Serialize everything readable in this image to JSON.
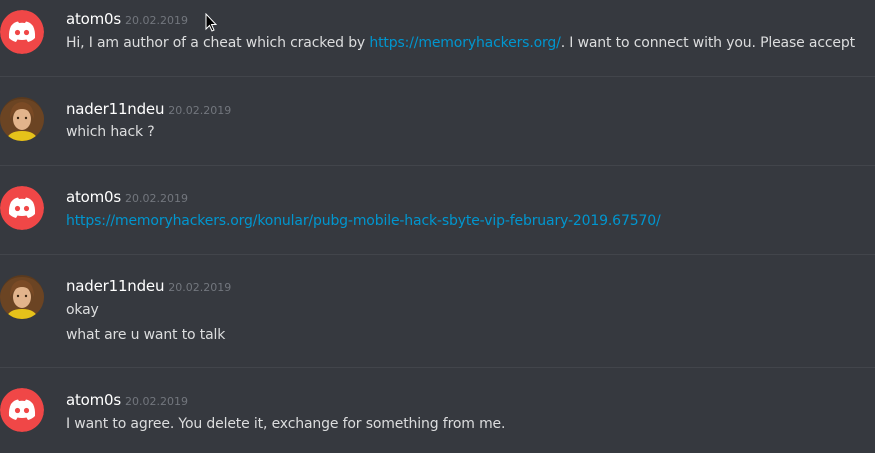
{
  "colors": {
    "background": "#36393f",
    "divider": "#42454b",
    "username": "#ffffff",
    "timestamp": "#72767d",
    "message_text": "#dcddde",
    "link": "#0096cf",
    "discord_avatar_bg": "#f04747"
  },
  "messages": [
    {
      "author": "atom0s",
      "timestamp": "20.02.2019",
      "avatar_icon": "discord-logo-icon",
      "lines": [
        {
          "prefix": "Hi, I am author of a cheat which cracked by ",
          "link": "https://memoryhackers.org/",
          "suffix": ". I want to connect with you. Please accept"
        }
      ]
    },
    {
      "author": "nader11ndeu",
      "timestamp": "20.02.2019",
      "avatar_icon": "user-photo-avatar",
      "lines": [
        {
          "text": "which hack ?"
        }
      ]
    },
    {
      "author": "atom0s",
      "timestamp": "20.02.2019",
      "avatar_icon": "discord-logo-icon",
      "lines": [
        {
          "link": "https://memoryhackers.org/konular/pubg-mobile-hack-sbyte-vip-february-2019.67570/"
        }
      ]
    },
    {
      "author": "nader11ndeu",
      "timestamp": "20.02.2019",
      "avatar_icon": "user-photo-avatar",
      "lines": [
        {
          "text": "okay"
        },
        {
          "text": "what are u want to talk"
        }
      ]
    },
    {
      "author": "atom0s",
      "timestamp": "20.02.2019",
      "avatar_icon": "discord-logo-icon",
      "lines": [
        {
          "text": "I want to agree. You delete it, exchange for something from me."
        }
      ]
    }
  ]
}
